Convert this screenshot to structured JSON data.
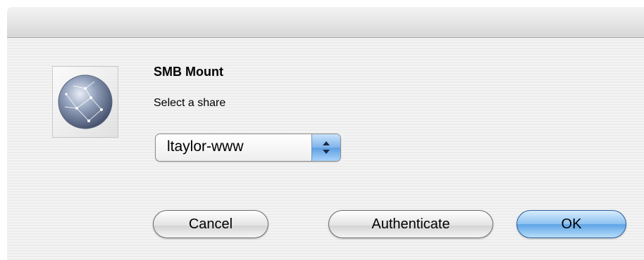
{
  "dialog": {
    "title": "SMB Mount",
    "prompt": "Select a share",
    "share_select": {
      "selected": "ltaylor-www"
    },
    "buttons": {
      "cancel": "Cancel",
      "authenticate": "Authenticate",
      "ok": "OK"
    },
    "icon": "network-globe-icon",
    "colors": {
      "default_button": "#5ba3e6",
      "popup_accent": "#7fb4ea"
    }
  }
}
